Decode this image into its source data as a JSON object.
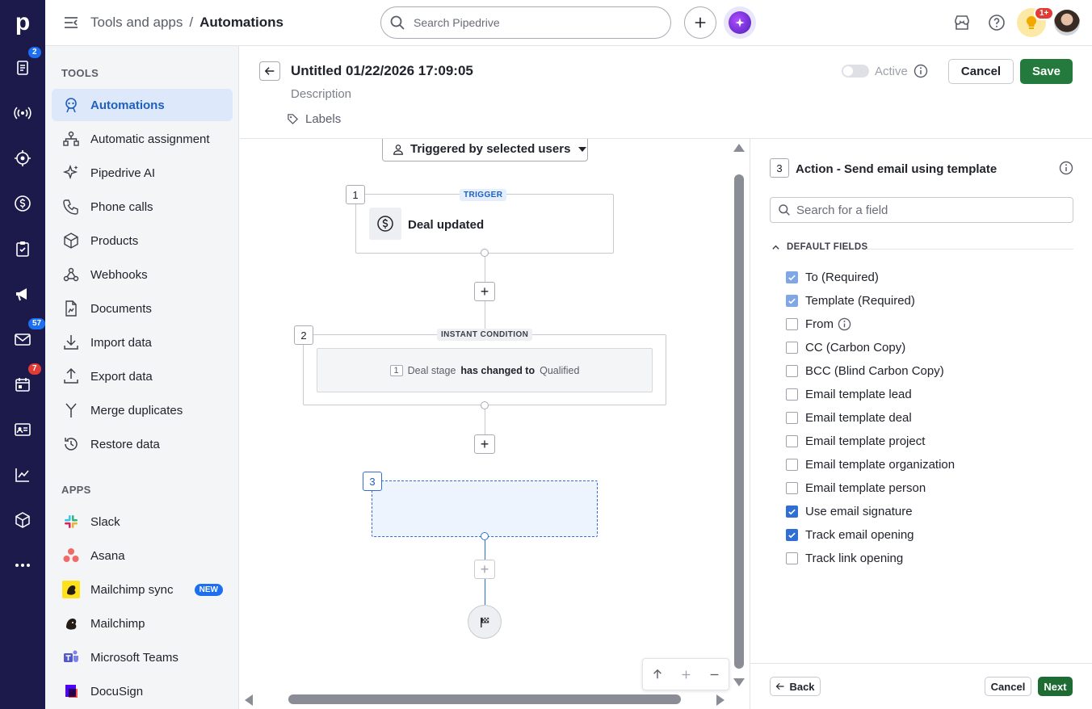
{
  "rail": {
    "logo": "p",
    "items": [
      {
        "name": "leads-icon",
        "badge": "2"
      },
      {
        "name": "broadcast-icon",
        "badge": ""
      },
      {
        "name": "target-icon",
        "badge": ""
      },
      {
        "name": "dollar-icon",
        "badge": ""
      },
      {
        "name": "clipboard-icon",
        "badge": ""
      },
      {
        "name": "megaphone-icon",
        "badge": ""
      },
      {
        "name": "mail-icon",
        "badge": "57"
      },
      {
        "name": "calendar-icon",
        "badge": "7"
      },
      {
        "name": "contacts-icon",
        "badge": ""
      },
      {
        "name": "chart-icon",
        "badge": ""
      },
      {
        "name": "box-icon",
        "badge": ""
      },
      {
        "name": "more-icon",
        "badge": ""
      }
    ]
  },
  "topbar": {
    "breadcrumb_root": "Tools and apps",
    "separator": "/",
    "breadcrumb_current": "Automations",
    "search_placeholder": "Search Pipedrive",
    "notification_badge": "1+"
  },
  "sidebar": {
    "tools_title": "TOOLS",
    "tools": [
      {
        "label": "Automations",
        "icon": "automation-icon",
        "active": true
      },
      {
        "label": "Automatic assignment",
        "icon": "assignment-icon"
      },
      {
        "label": "Pipedrive AI",
        "icon": "sparkle-icon"
      },
      {
        "label": "Phone calls",
        "icon": "phone-icon"
      },
      {
        "label": "Products",
        "icon": "box-icon"
      },
      {
        "label": "Webhooks",
        "icon": "webhook-icon"
      },
      {
        "label": "Documents",
        "icon": "document-icon"
      },
      {
        "label": "Import data",
        "icon": "import-icon"
      },
      {
        "label": "Export data",
        "icon": "export-icon"
      },
      {
        "label": "Merge duplicates",
        "icon": "merge-icon"
      },
      {
        "label": "Restore data",
        "icon": "restore-icon"
      }
    ],
    "apps_title": "APPS",
    "apps": [
      {
        "label": "Slack",
        "icon": "slack-icon"
      },
      {
        "label": "Asana",
        "icon": "asana-icon"
      },
      {
        "label": "Mailchimp sync",
        "icon": "mailchimp-sync-icon",
        "badge": "NEW"
      },
      {
        "label": "Mailchimp",
        "icon": "mailchimp-icon"
      },
      {
        "label": "Microsoft Teams",
        "icon": "teams-icon"
      },
      {
        "label": "DocuSign",
        "icon": "docusign-icon"
      }
    ]
  },
  "editor": {
    "title": "Untitled 01/22/2026 17:09:05",
    "description_placeholder": "Description",
    "labels": "Labels",
    "active_label": "Active",
    "cancel": "Cancel",
    "save": "Save"
  },
  "canvas": {
    "trigger_scope": "Triggered by selected users",
    "step1": {
      "num": "1",
      "tag": "TRIGGER",
      "label": "Deal updated"
    },
    "step2": {
      "num": "2",
      "tag": "INSTANT CONDITION",
      "cond_num": "1",
      "field": "Deal stage",
      "op": "has changed to",
      "value": "Qualified"
    },
    "step3": {
      "num": "3"
    }
  },
  "panel": {
    "step_num": "3",
    "title": "Action - Send email using template",
    "search_placeholder": "Search for a field",
    "section": "DEFAULT FIELDS",
    "fields": [
      {
        "label": "To (Required)",
        "state": "disabled-checked"
      },
      {
        "label": "Template (Required)",
        "state": "disabled-checked"
      },
      {
        "label": "From",
        "state": "unchecked",
        "info": true
      },
      {
        "label": "CC (Carbon Copy)",
        "state": "unchecked"
      },
      {
        "label": "BCC (Blind Carbon Copy)",
        "state": "unchecked"
      },
      {
        "label": "Email template lead",
        "state": "unchecked"
      },
      {
        "label": "Email template deal",
        "state": "unchecked"
      },
      {
        "label": "Email template project",
        "state": "unchecked"
      },
      {
        "label": "Email template organization",
        "state": "unchecked"
      },
      {
        "label": "Email template person",
        "state": "unchecked"
      },
      {
        "label": "Use email signature",
        "state": "checked"
      },
      {
        "label": "Track email opening",
        "state": "checked"
      },
      {
        "label": "Track link opening",
        "state": "unchecked"
      }
    ],
    "back": "Back",
    "cancel": "Cancel",
    "next": "Next"
  },
  "colors": {
    "rail": "#1b1a4b",
    "accent": "#1f5fbf",
    "save_green": "#247a3c",
    "next_green": "#1e6b34"
  }
}
